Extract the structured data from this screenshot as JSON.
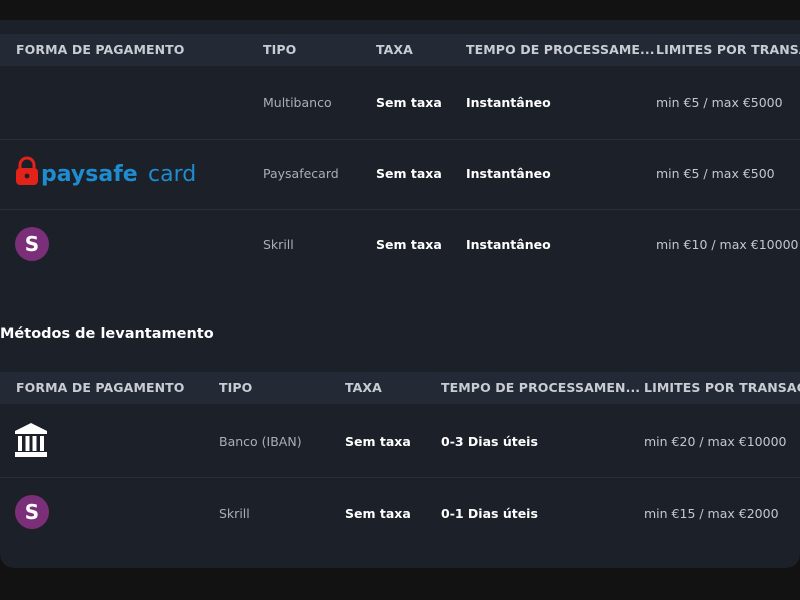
{
  "deposits": {
    "headers": {
      "method": "FORMA DE PAGAMENTO",
      "type": "TIPO",
      "fee": "TAXA",
      "time": "TEMPO DE PROCESSAME...",
      "limits": "LIMITES POR TRANSA..."
    },
    "rows": [
      {
        "icon": "none",
        "type": "Multibanco",
        "fee": "Sem taxa",
        "time": "Instantâneo",
        "limits": "min €5 / max €5000"
      },
      {
        "icon": "paysafecard-logo",
        "logo_text_a": "paysafe",
        "logo_text_b": "card",
        "type": "Paysafecard",
        "fee": "Sem taxa",
        "time": "Instantâneo",
        "limits": "min €5 / max €500"
      },
      {
        "icon": "skrill-icon",
        "icon_letter": "S",
        "type": "Skrill",
        "fee": "Sem taxa",
        "time": "Instantâneo",
        "limits": "min €10 / max €10000"
      }
    ]
  },
  "withdrawals": {
    "title": "Métodos de levantamento",
    "headers": {
      "method": "FORMA DE PAGAMENTO",
      "type": "TIPO",
      "fee": "TAXA",
      "time": "TEMPO DE PROCESSAMEN...",
      "limits": "LIMITES POR TRANSAÇÃ"
    },
    "rows": [
      {
        "icon": "bank-icon",
        "type": "Banco (IBAN)",
        "fee": "Sem taxa",
        "time": "0-3 Dias úteis",
        "limits": "min €20 / max €10000"
      },
      {
        "icon": "skrill-icon",
        "icon_letter": "S",
        "type": "Skrill",
        "fee": "Sem taxa",
        "time": "0-1 Dias úteis",
        "limits": "min €15 / max €2000"
      }
    ]
  },
  "colors": {
    "background": "#121212",
    "panel": "#1b2029",
    "header": "#232a35",
    "skrill": "#7b2f78",
    "paysafe_red": "#e2231a",
    "paysafe_blue": "#1f8ccf"
  }
}
